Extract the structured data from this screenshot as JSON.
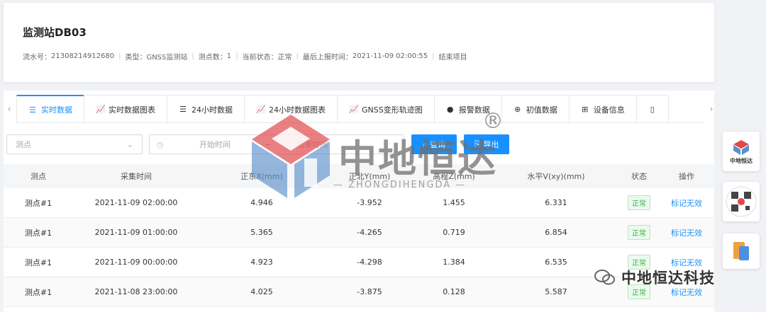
{
  "station": {
    "title": "监测站DB03",
    "meta": [
      {
        "label": "流水号：",
        "value": "21308214912680"
      },
      {
        "label": "类型：",
        "value": "GNSS监测站"
      },
      {
        "label": "测点数：",
        "value": "1"
      },
      {
        "label": "当前状态：",
        "value": "正常"
      },
      {
        "label": "最后上报时间：",
        "value": "2021-11-09 02:00:55"
      }
    ],
    "end_project": "结束项目"
  },
  "tabs": [
    {
      "label": "实时数据",
      "icon": "list-icon",
      "active": true
    },
    {
      "label": "实时数据图表",
      "icon": "line-chart-icon",
      "active": false
    },
    {
      "label": "24小时数据",
      "icon": "list-icon",
      "active": false
    },
    {
      "label": "24小时数据图表",
      "icon": "line-chart-icon",
      "active": false
    },
    {
      "label": "GNSS变形轨迹图",
      "icon": "line-chart-icon",
      "active": false
    },
    {
      "label": "报警数据",
      "icon": "alert-icon",
      "active": false
    },
    {
      "label": "初值数据",
      "icon": "globe-icon",
      "active": false
    },
    {
      "label": "设备信息",
      "icon": "device-icon",
      "active": false
    },
    {
      "label": "",
      "icon": "more-icon",
      "active": false
    }
  ],
  "filters": {
    "point_placeholder": "测点",
    "start_placeholder": "开始时间",
    "range_sep": "~",
    "end_placeholder": "结束时间",
    "query_label": "查询",
    "export_label": "导出"
  },
  "table": {
    "headers": [
      "测点",
      "采集时间",
      "正东X(mm)",
      "正北Y(mm)",
      "高程Z(mm)",
      "水平V(xy)(mm)",
      "状态",
      "操作"
    ],
    "rows": [
      {
        "point": "测点#1",
        "time": "2021-11-09 02:00:00",
        "x": "4.946",
        "y": "-3.952",
        "z": "1.455",
        "v": "6.331",
        "status": "正常",
        "action": "标记无效"
      },
      {
        "point": "测点#1",
        "time": "2021-11-09 01:00:00",
        "x": "5.365",
        "y": "-4.265",
        "z": "0.719",
        "v": "6.854",
        "status": "正常",
        "action": "标记无效"
      },
      {
        "point": "测点#1",
        "time": "2021-11-09 00:00:00",
        "x": "4.923",
        "y": "-4.298",
        "z": "1.384",
        "v": "6.535",
        "status": "正常",
        "action": "标记无效"
      },
      {
        "point": "测点#1",
        "time": "2021-11-08 23:00:00",
        "x": "4.025",
        "y": "-3.875",
        "z": "0.128",
        "v": "5.587",
        "status": "正常",
        "action": "标记无效"
      }
    ]
  },
  "watermark": {
    "brand": "中地恒达",
    "reg_mark": "®",
    "subtitle": "ZHONGDIHENGDA",
    "wechat": "中地恒达科技"
  },
  "side": {
    "logo_text": "中地恒达"
  },
  "colors": {
    "primary": "#1890ff",
    "success": "#37b24d",
    "logo_red": "#e0474c",
    "logo_blue": "#5b8fc9"
  }
}
